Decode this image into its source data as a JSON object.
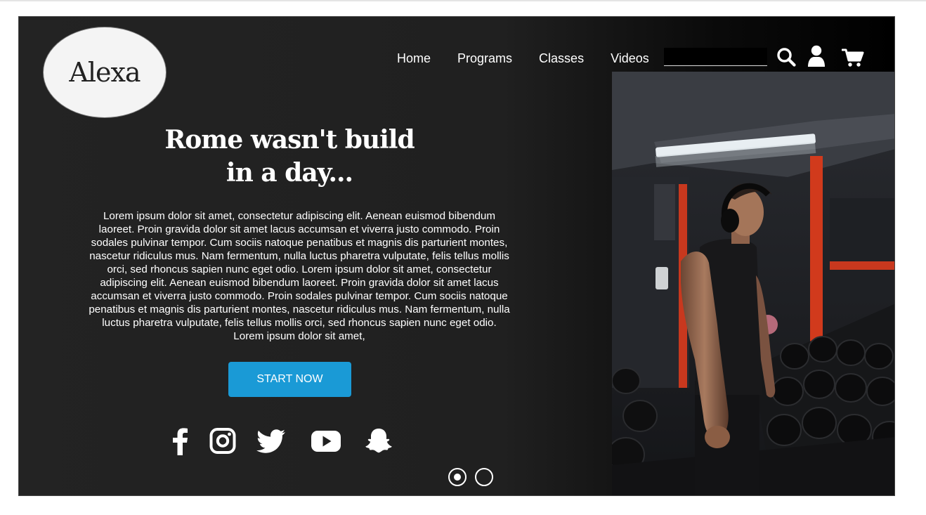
{
  "brand": {
    "logo_text": "Alexa"
  },
  "nav": {
    "items": [
      "Home",
      "Programs",
      "Classes",
      "Videos"
    ]
  },
  "search": {
    "value": "",
    "placeholder": ""
  },
  "icons": {
    "search": "search-icon",
    "user": "user-icon",
    "cart": "cart-icon"
  },
  "hero": {
    "headline_line1": "Rome wasn't build",
    "headline_line2": "in a day...",
    "body": "Lorem ipsum dolor sit amet, consectetur adipiscing elit. Aenean euismod bibendum laoreet. Proin gravida dolor sit amet lacus accumsan et viverra justo commodo. Proin sodales pulvinar tempor. Cum sociis natoque penatibus et magnis dis parturient montes, nascetur ridiculus mus. Nam fermentum, nulla luctus pharetra vulputate, felis tellus mollis orci, sed rhoncus sapien nunc eget odio. Lorem ipsum dolor sit amet, consectetur adipiscing elit. Aenean euismod bibendum laoreet. Proin gravida dolor sit amet lacus accumsan et viverra justo commodo. Proin sodales pulvinar tempor. Cum sociis natoque penatibus et magnis dis parturient montes, nascetur ridiculus mus. Nam fermentum, nulla luctus pharetra vulputate, felis tellus mollis orci, sed rhoncus sapien nunc eget odio. Lorem ipsum dolor sit amet,",
    "cta_label": "START NOW"
  },
  "social": [
    "facebook-icon",
    "instagram-icon",
    "twitter-icon",
    "youtube-icon",
    "snapchat-icon"
  ],
  "carousel": {
    "slide_count": 2,
    "active_index": 0
  },
  "colors": {
    "accent": "#1a9ad6",
    "background": "#212121",
    "text": "#ffffff"
  }
}
